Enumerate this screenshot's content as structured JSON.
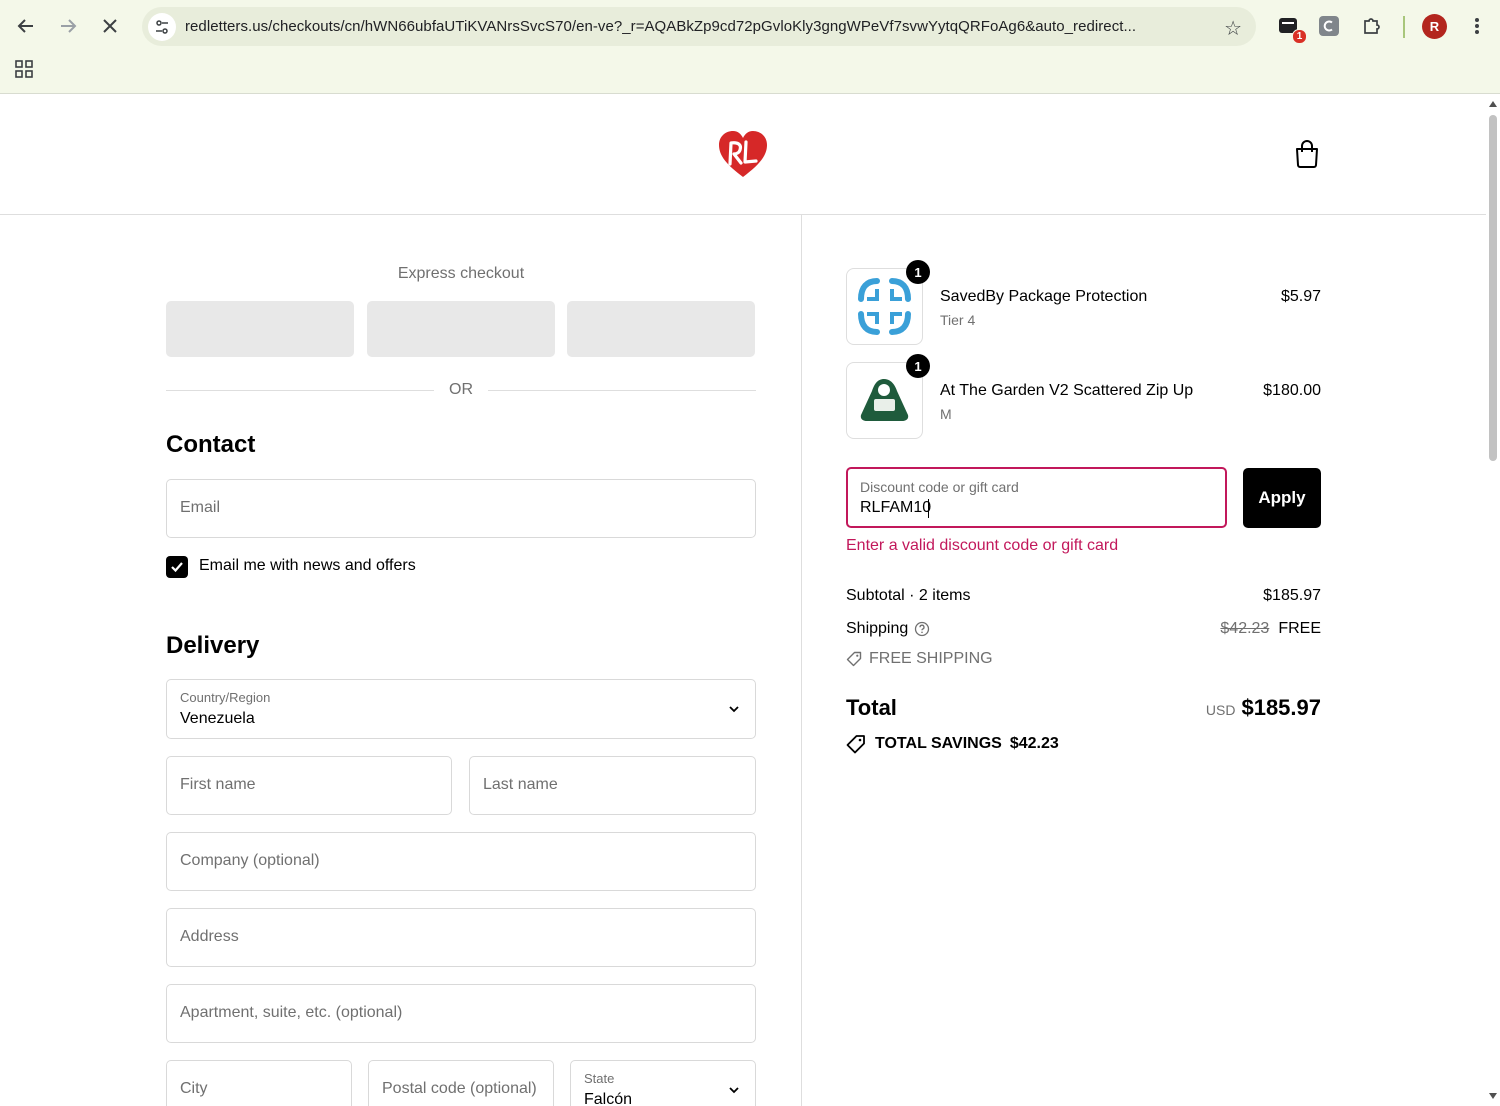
{
  "browser": {
    "url": "redletters.us/checkouts/cn/hWN66ubfaUTiKVANrsSvcS70/en-ve?_r=AQABkZp9cd72pGvloKly3gngWPeVf7svwYytqQRFoAg6&auto_redirect...",
    "profile_initial": "R",
    "extension_badge": "1"
  },
  "express": {
    "title": "Express checkout",
    "or": "OR"
  },
  "contact": {
    "heading": "Contact",
    "email_placeholder": "Email",
    "newsletter_label": "Email me with news and offers",
    "newsletter_checked": true
  },
  "delivery": {
    "heading": "Delivery",
    "country_label": "Country/Region",
    "country_value": "Venezuela",
    "first_name": "First name",
    "last_name": "Last name",
    "company": "Company (optional)",
    "address": "Address",
    "apartment": "Apartment, suite, etc. (optional)",
    "city": "City",
    "postal": "Postal code (optional)",
    "state_label": "State",
    "state_value": "Falcón"
  },
  "cart": {
    "items": [
      {
        "name": "SavedBy Package Protection",
        "variant": "Tier 4",
        "price": "$5.97",
        "qty": "1"
      },
      {
        "name": "At The Garden V2 Scattered Zip Up",
        "variant": "M",
        "price": "$180.00",
        "qty": "1"
      }
    ],
    "discount_label": "Discount code or gift card",
    "discount_value": "RLFAM10",
    "apply_label": "Apply",
    "error": "Enter a valid discount code or gift card",
    "subtotal_label": "Subtotal · 2 items",
    "subtotal_value": "$185.97",
    "shipping_label": "Shipping",
    "shipping_old": "$42.23",
    "shipping_value": "FREE",
    "free_shipping_tag": "FREE SHIPPING",
    "total_label": "Total",
    "total_currency": "USD",
    "total_value": "$185.97",
    "savings_label": "TOTAL SAVINGS",
    "savings_value": "$42.23"
  },
  "colors": {
    "error": "#c2185b",
    "logo_red": "#d62828",
    "chrome_bg": "#f4f8e9"
  }
}
